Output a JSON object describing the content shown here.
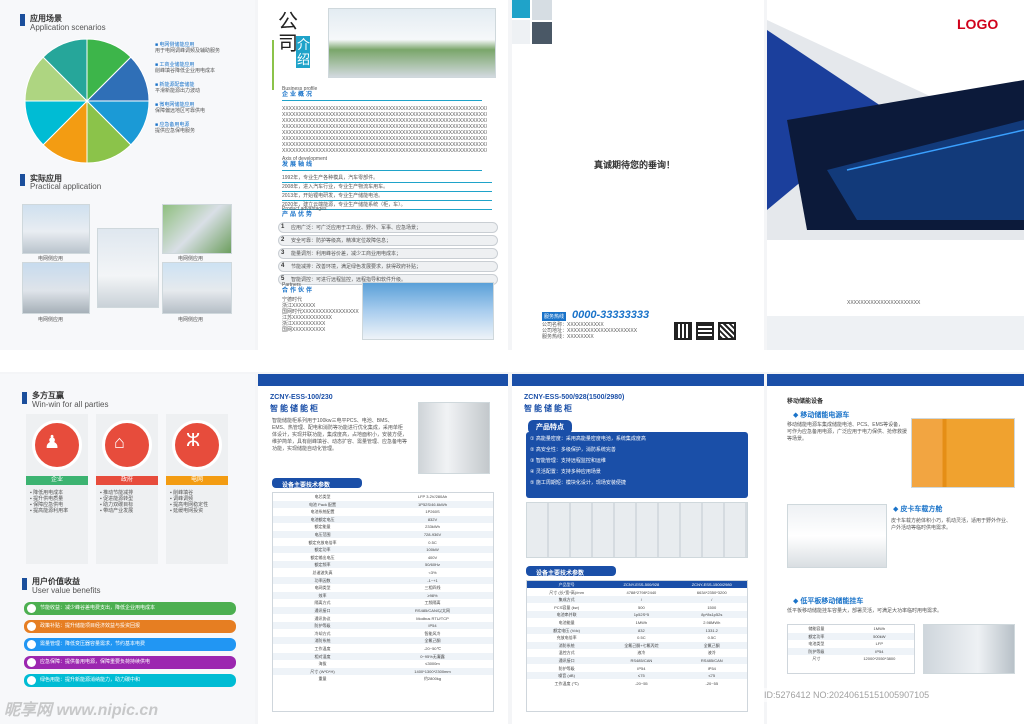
{
  "top": {
    "p1": {
      "scenario_cn": "应用场景",
      "scenario_en": "Application scenarios",
      "practical_cn": "实际应用",
      "practical_en": "Practical application",
      "pie_colors": [
        "#3db54a",
        "#2f6fb7",
        "#1b9ad6",
        "#8bc34a",
        "#f39c12",
        "#00bcd4",
        "#aed581",
        "#26a69a"
      ],
      "photo_caption": "电网侧应用"
    },
    "p2": {
      "company_big": "公司",
      "company_sub": "介绍",
      "profile_en": "Business profile",
      "profile_cn": "企业概况",
      "profile_text": "XXXXXXXXXXXXXXXXXXXXXXXXXXXXXXXXXXXXXXXXXXXXXXXXXXXXXXXXXXXXXX",
      "axis_en": "Axis of development",
      "axis_cn": "发展轴线",
      "axis_items": [
        "1992年，专业生产各种模具，汽车零部件。",
        "2008年，进入汽车行业，专业生产物流车用车。",
        "2013年，开始锂电研发，专业生产储能电池。",
        "2020年，建立云端能源，专业生产储能系统（柜，车）。"
      ],
      "adv_en": "Product advantages",
      "adv_cn": "产品优势",
      "advantages": [
        "应用广泛：可广泛应用于工商业、野外、军事、应急场景；",
        "安全可靠：防护等级高，精准定位故障信息；",
        "能量调剂：利用峰谷价差，减少工商业用电成本；",
        "节能减排：改善环境，满足绿色发展要求，获得政府补贴；",
        "智能调控：可进行远程监控，远程指导和软件升级。"
      ],
      "partner_en": "Partners",
      "partner_cn": "合作伙伴",
      "partners": [
        "宁德时代",
        "浙江XXXXXXX",
        "国网时代XXXXXXXXXXXXXXXXX",
        "江苏XXXXXXXXXXXX",
        "浙江XXXXXXXXXX",
        "国网XXXXXXXXXX"
      ]
    },
    "p3": {
      "slogan": "真诚期待您的垂询！",
      "hotline_label": "服务热线",
      "hotline": "0000-33333333",
      "contact": [
        {
          "label": "公司名称：",
          "value": "XXXXXXXXXXX"
        },
        {
          "label": "公司地址：",
          "value": "XXXXXXXXXXXXXXXXXXXXX"
        },
        {
          "label": "服务热线：",
          "value": "XXXXXXXX"
        }
      ]
    },
    "p4": {
      "logo": "LOGO",
      "cover_text": "XXXXXXXXXXXXXXXXXXXXXX"
    }
  },
  "bottom": {
    "p1": {
      "win_cn": "多方互赢",
      "win_en": "Win-win for all parties",
      "cards": [
        {
          "title": "企业",
          "color": "#3cb371"
        },
        {
          "title": "政府",
          "color": "#e74c3c"
        },
        {
          "title": "电网",
          "color": "#f39c12"
        }
      ],
      "benefit_cn": "用户价值收益",
      "benefit_en": "User value benefits",
      "benefits": [
        {
          "text": "节能收益：减少峰谷差电费支出，降低企业用电成本",
          "color": "#4caf50"
        },
        {
          "text": "政策补贴：提升储能项目经济效益与投资回报",
          "color": "#e67e22"
        },
        {
          "text": "需量管理：降低变压器容量需求，节约基本电费",
          "color": "#2196f3"
        },
        {
          "text": "应急保障：提供备用电源，保障重要负荷持续供电",
          "color": "#9c27b0"
        },
        {
          "text": "绿色用能：提升新能源消纳能力，助力碳中和",
          "color": "#00bcd4"
        }
      ]
    },
    "p2": {
      "model": "ZCNY-ESS-100/230",
      "name": "智能储能柜",
      "desc": "智能储能柜系列用于100kw三电平PCS、电池、BMS、EMS、热管理、配电和消防等功能进行优化集成，采用单柜体设计，实现并联功能，集成度高，占地面积小，安装方便，维护简单，具有削峰填谷、动态扩容、需量管理、应急备电等功能，实现储能自动化管理。",
      "table_title": "设备主要技术参数",
      "rows": [
        [
          "电芯类型",
          "LFP 3.2V/280Ah"
        ],
        [
          "电池 Pack 配置",
          "1P52S/46.6kWh"
        ],
        [
          "电池系统配置",
          "1P260S"
        ],
        [
          "电池额定电压",
          "832V"
        ],
        [
          "额定能量",
          "233kWh"
        ],
        [
          "电压范围",
          "728-936V"
        ],
        [
          "额定充放电倍率",
          "0.5C"
        ],
        [
          "额定功率",
          "100kW"
        ],
        [
          "额定输出电压",
          "400V"
        ],
        [
          "额定频率",
          "50/60Hz"
        ],
        [
          "总谐波失真",
          "<3%"
        ],
        [
          "功率因数",
          "-1~+1"
        ],
        [
          "电网类型",
          "三相四线"
        ],
        [
          "效率",
          "≥98%"
        ],
        [
          "隔离方式",
          "工频隔离"
        ],
        [
          "通讯接口",
          "RS485/CAN/以太网"
        ],
        [
          "通讯协议",
          "Modbus RTU/TCP"
        ],
        [
          "防护等级",
          "IP54"
        ],
        [
          "冷却方式",
          "智能风冷"
        ],
        [
          "消防系统",
          "全氟己酮"
        ],
        [
          "工作温度",
          "-20~50℃"
        ],
        [
          "相对湿度",
          "0~95%无凝露"
        ],
        [
          "海拔",
          "≤3000m"
        ],
        [
          "尺寸 (W*D*H)",
          "1400*1300*2300mm"
        ],
        [
          "重量",
          "约2800kg"
        ]
      ]
    },
    "p3": {
      "model": "ZCNY-ESS-500/928(1500/2980)",
      "name": "智能储能柜",
      "features_title": "产品特点",
      "features": [
        "高能量密度：采用高能量密度电池，系统集成度高",
        "高安全性：多级保护，消防系统完善",
        "智能管理：支持远程监控和运维",
        "灵活配置：支持多种应用场景",
        "施工周期短：模块化设计，现场安装便捷"
      ],
      "table_title": "设备主要技术参数",
      "head": [
        "产品型号",
        "ZCNY-ESS-500/928",
        "ZCNY-ESS-1500/2980"
      ],
      "rows": [
        [
          "尺寸 (长*宽*高)/mm",
          "4788*2798*2440",
          "6634*2350*3200"
        ],
        [
          "集成方式",
          "/",
          "/"
        ],
        [
          "PCS容量 (kw)",
          "500",
          "1500"
        ],
        [
          "电池串并联",
          "1p52S*5",
          "8p*8s1p52s"
        ],
        [
          "电池能量",
          "1MWh",
          "2.98MWh"
        ],
        [
          "额定电压 (Vdc)",
          "832",
          "1331.2"
        ],
        [
          "充放电倍率",
          "0.5C",
          "0.5C"
        ],
        [
          "消防系统",
          "全氟己酮+七氟丙烷",
          "全氟己酮"
        ],
        [
          "温控方式",
          "液冷",
          "液冷"
        ],
        [
          "通讯接口",
          "RS485/CAN",
          "RS485/CAN"
        ],
        [
          "防护等级",
          "IP54",
          "IP54"
        ],
        [
          "噪音 (dB)",
          "≤75",
          "≤75"
        ],
        [
          "工作温度 (℃)",
          "-20~55",
          "-20~55"
        ]
      ]
    },
    "p4": {
      "section_title": "移动储能设备",
      "items": [
        {
          "title": "移动储能电源车",
          "text": "移动储能电源车集成储能电池、PCS、EMS等设备，可作为应急备用电源，广泛应用于电力保供、抢修救援等场景。"
        },
        {
          "title": "皮卡车载方舱",
          "text": "皮卡车载方舱体积小巧，机动灵活，适用于野外作业、户外活动等临时供电需求。"
        },
        {
          "title": "低平板移动储能挂车",
          "text": "低平板移动储能挂车容量大，部署灵活，可满足大功率临时用电需求。"
        }
      ],
      "spec_rows": [
        [
          "储能容量",
          "1MWh"
        ],
        [
          "额定功率",
          "500kW"
        ],
        [
          "电池类型",
          "LFP"
        ],
        [
          "防护等级",
          "IP54"
        ],
        [
          "尺寸",
          "12000*2550*3800"
        ]
      ]
    }
  },
  "watermark": {
    "left": "昵享网 www.nipic.cn",
    "right": "ID:5276412 NO:20240615151005907105"
  }
}
